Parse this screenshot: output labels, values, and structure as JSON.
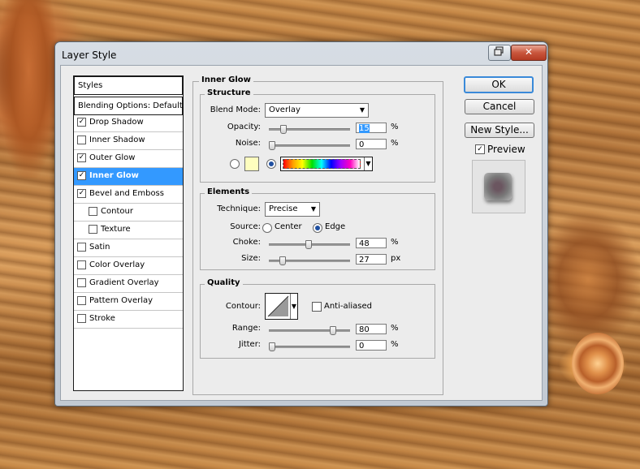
{
  "window": {
    "title": "Layer Style",
    "close_glyph": "✕"
  },
  "styles_panel": {
    "header": "Styles",
    "blending": "Blending Options: Default",
    "items": [
      {
        "label": "Drop Shadow",
        "checked": true
      },
      {
        "label": "Inner Shadow",
        "checked": false
      },
      {
        "label": "Outer Glow",
        "checked": true
      },
      {
        "label": "Inner Glow",
        "checked": true,
        "selected": true
      },
      {
        "label": "Bevel and Emboss",
        "checked": true
      },
      {
        "label": "Contour",
        "checked": false,
        "indent": true
      },
      {
        "label": "Texture",
        "checked": false,
        "indent": true
      },
      {
        "label": "Satin",
        "checked": false
      },
      {
        "label": "Color Overlay",
        "checked": false
      },
      {
        "label": "Gradient Overlay",
        "checked": false
      },
      {
        "label": "Pattern Overlay",
        "checked": false
      },
      {
        "label": "Stroke",
        "checked": false
      }
    ]
  },
  "inner_glow": {
    "title": "Inner Glow",
    "structure": {
      "title": "Structure",
      "blend_mode_label": "Blend Mode:",
      "blend_mode_value": "Overlay",
      "opacity_label": "Opacity:",
      "opacity_value": "15",
      "opacity_level": 15,
      "noise_label": "Noise:",
      "noise_value": "0",
      "noise_level": 0,
      "unit": "%",
      "swatch_color": "#fefebe"
    },
    "elements": {
      "title": "Elements",
      "technique_label": "Technique:",
      "technique_value": "Precise",
      "source_label": "Source:",
      "source_center": "Center",
      "source_edge": "Edge",
      "choke_label": "Choke:",
      "choke_value": "48",
      "choke_level": 48,
      "choke_unit": "%",
      "size_label": "Size:",
      "size_value": "27",
      "size_unit": "px"
    },
    "quality": {
      "title": "Quality",
      "contour_label": "Contour:",
      "anti_aliased_label": "Anti-aliased",
      "range_label": "Range:",
      "range_value": "80",
      "range_level": 80,
      "range_unit": "%",
      "jitter_label": "Jitter:",
      "jitter_value": "0",
      "jitter_level": 0,
      "jitter_unit": "%"
    }
  },
  "buttons": {
    "ok": "OK",
    "cancel": "Cancel",
    "new_style": "New Style...",
    "preview": "Preview"
  },
  "colors": {
    "selection": "#3399ff",
    "accent": "#3a8ad9"
  }
}
